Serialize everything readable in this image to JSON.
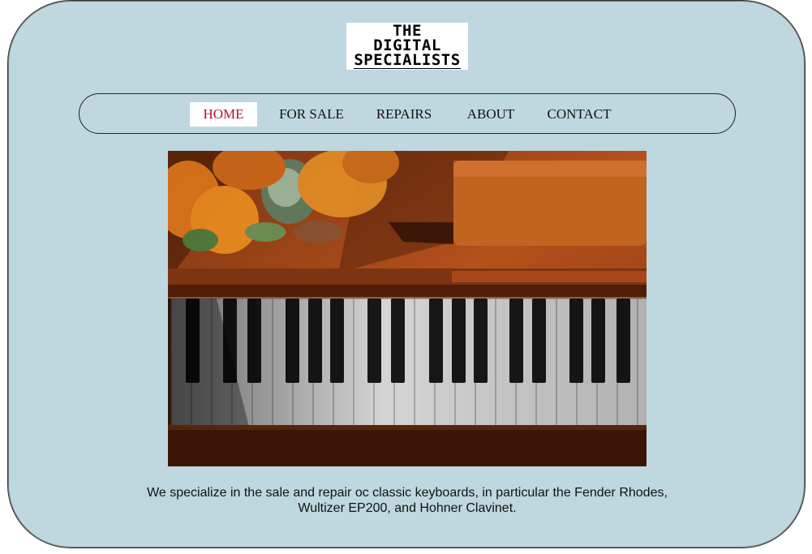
{
  "logo": {
    "line1": "THE",
    "line2": "DIGITAL",
    "line3": "SPECIALISTS"
  },
  "nav": {
    "items": [
      {
        "label": "HOME",
        "active": true
      },
      {
        "label": "FOR SALE",
        "active": false
      },
      {
        "label": "REPAIRS",
        "active": false
      },
      {
        "label": "ABOUT",
        "active": false
      },
      {
        "label": "CONTACT",
        "active": false
      }
    ]
  },
  "hero": {
    "subject": "piano-keyboard-with-flowers-photo"
  },
  "intro_text": "We specialize in the sale and repair oc classic keyboards, in particular the Fender Rhodes, Wultizer EP200, and Hohner Clavinet.",
  "colors": {
    "background": "#bfd7df",
    "active_nav_text": "#b0103a",
    "active_nav_bg": "#ffffff",
    "wood": "#b4501b"
  }
}
